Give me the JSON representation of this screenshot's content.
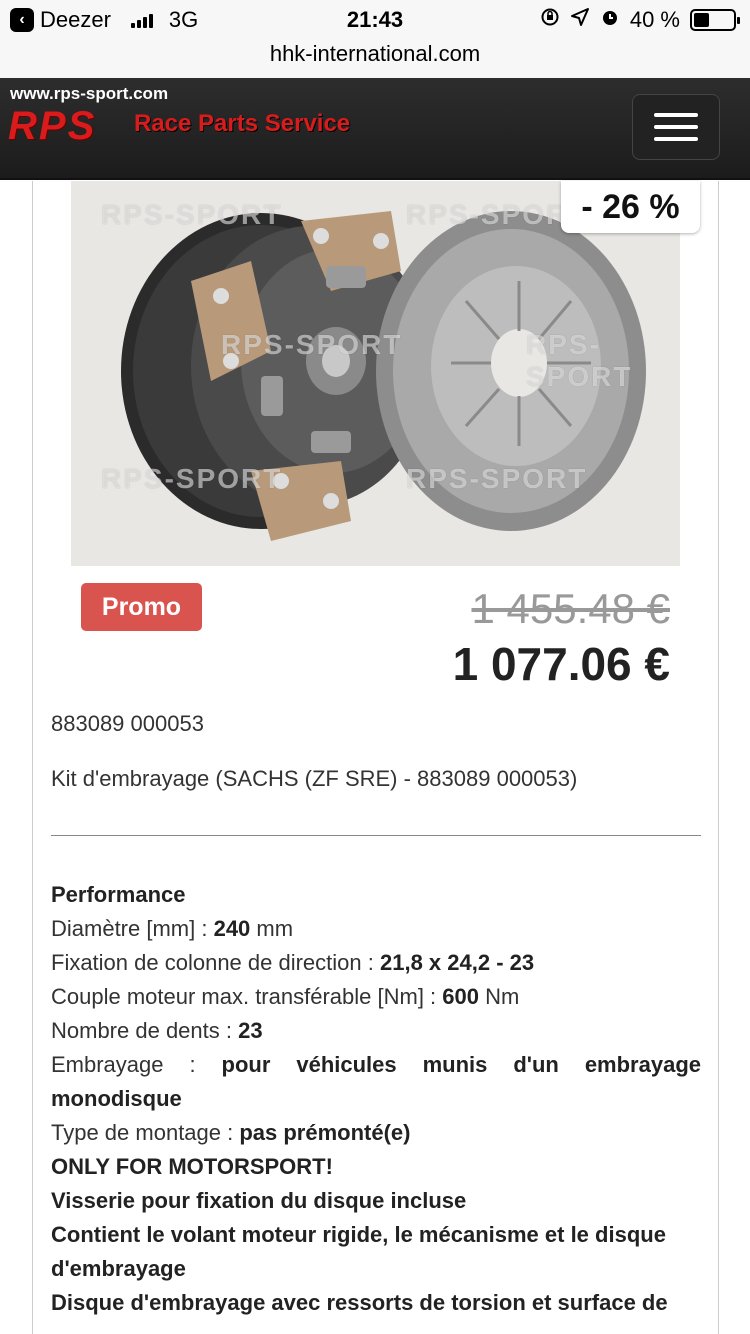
{
  "status_bar": {
    "carrier": "Deezer",
    "network": "3G",
    "time": "21:43",
    "battery_text": "40 %",
    "battery_level": 0.4
  },
  "url_bar": {
    "domain": "hhk-international.com"
  },
  "site_header": {
    "site_url": "www.rps-sport.com",
    "logo_text": "RPS",
    "logo_tagline": "Race Parts Service",
    "menu_icon": "hamburger-icon"
  },
  "product": {
    "image_alt": "clutch kit",
    "watermark": "RPS-SPORT",
    "discount": "- 26 %",
    "promo_label": "Promo",
    "old_price": "1 455.48 €",
    "new_price": "1 077.06 €",
    "reference": "883089 000053",
    "title": "Kit d'embrayage (SACHS (ZF SRE) - 883089 000053)"
  },
  "specs": {
    "heading": "Performance",
    "diameter_label": "Diamètre [mm] : ",
    "diameter_value": "240",
    "diameter_unit": " mm",
    "steering_label": "Fixation de colonne de direction : ",
    "steering_value": "21,8 x 24,2 - 23",
    "torque_label": "Couple moteur max. transférable [Nm] : ",
    "torque_value": "600",
    "torque_unit": " Nm",
    "teeth_label": "Nombre de dents : ",
    "teeth_value": "23",
    "clutch_label": "Embrayage : ",
    "clutch_value": "pour véhicules munis d'un embrayage monodisque",
    "mount_label": "Type de montage : ",
    "mount_value": "pas prémonté(e)",
    "note1": "ONLY FOR MOTORSPORT!",
    "note2": "Visserie pour fixation du disque incluse",
    "note3": "Contient le volant moteur rigide, le mécanisme et le disque d'embrayage",
    "note4": "Disque d'embrayage avec ressorts de torsion et surface de"
  }
}
